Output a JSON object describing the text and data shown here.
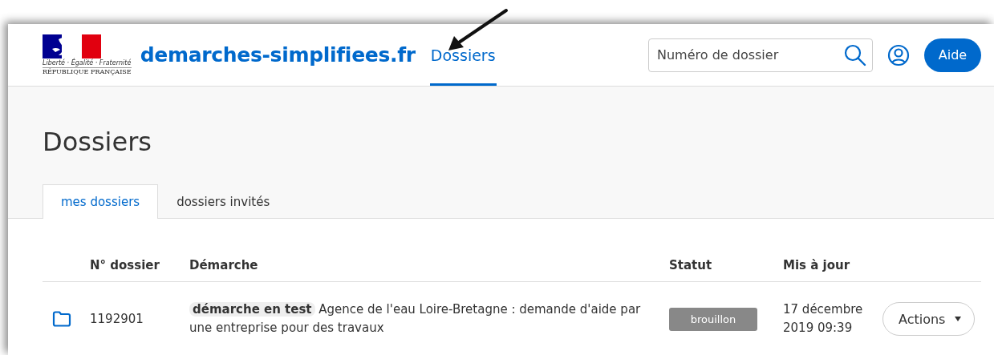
{
  "header": {
    "logo": {
      "motto": "Liberté · Égalité · Fraternité",
      "republic": "RÉPUBLIQUE FRANÇAISE"
    },
    "site_title": "demarches-simplifiees.fr",
    "nav": [
      {
        "label": "Dossiers",
        "selected": true
      }
    ],
    "search": {
      "placeholder": "Numéro de dossier"
    },
    "help_button": "Aide"
  },
  "page_title": "Dossiers",
  "tabs": [
    {
      "label": "mes dossiers",
      "selected": true
    },
    {
      "label": "dossiers invités",
      "selected": false
    }
  ],
  "table": {
    "columns": [
      "N° dossier",
      "Démarche",
      "Statut",
      "Mis à jour"
    ],
    "rows": [
      {
        "number": "1192901",
        "tag": "démarche en test",
        "demarche": "Agence de l'eau Loire-Bretagne : demande d'aide par une entreprise pour des travaux",
        "status": "brouillon",
        "updated": "17 décembre 2019 09:39",
        "action": "Actions"
      }
    ]
  }
}
